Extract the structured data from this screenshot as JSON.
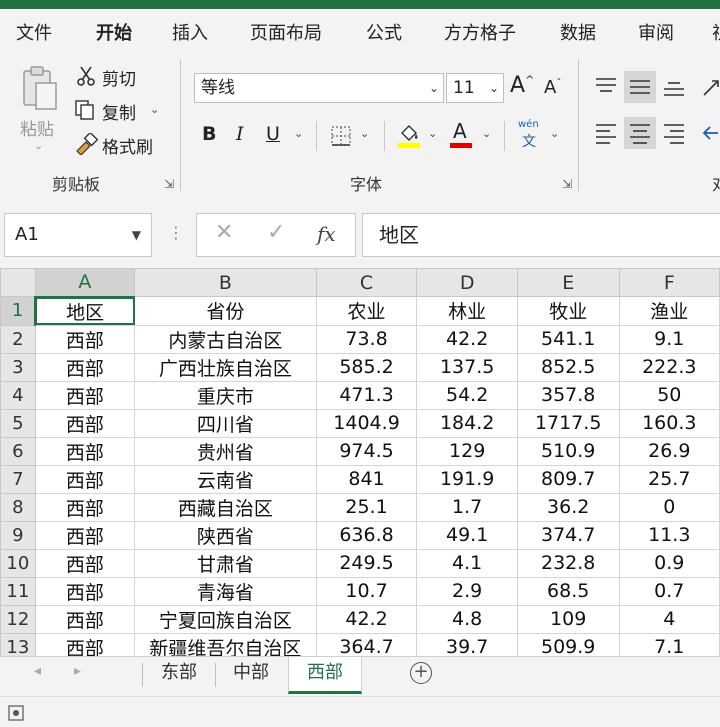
{
  "menu": {
    "tabs": [
      "文件",
      "开始",
      "插入",
      "页面布局",
      "公式",
      "方方格子",
      "数据",
      "审阅",
      "视"
    ],
    "active_index": 1
  },
  "ribbon": {
    "clipboard": {
      "paste": "粘贴",
      "cut": "剪切",
      "copy": "复制",
      "format_painter": "格式刷",
      "label": "剪贴板"
    },
    "font": {
      "font_name": "等线",
      "font_size": "11",
      "grow": "A",
      "shrink": "A",
      "bold": "B",
      "italic": "I",
      "underline": "U",
      "font_color_letter": "A",
      "phonetic_top": "wén",
      "phonetic_bottom": "文",
      "label": "字体",
      "fill_color": "#ffff00",
      "font_color": "#e00000"
    },
    "alignment": {
      "label_partial": "对"
    }
  },
  "formula_bar": {
    "name_box": "A1",
    "fx": "fx",
    "content": "地区"
  },
  "sheet": {
    "columns": [
      "A",
      "B",
      "C",
      "D",
      "E",
      "F"
    ],
    "rows": [
      [
        "地区",
        "省份",
        "农业",
        "林业",
        "牧业",
        "渔业"
      ],
      [
        "西部",
        "内蒙古自治区",
        "73.8",
        "42.2",
        "541.1",
        "9.1"
      ],
      [
        "西部",
        "广西壮族自治区",
        "585.2",
        "137.5",
        "852.5",
        "222.3"
      ],
      [
        "西部",
        "重庆市",
        "471.3",
        "54.2",
        "357.8",
        "50"
      ],
      [
        "西部",
        "四川省",
        "1404.9",
        "184.2",
        "1717.5",
        "160.3"
      ],
      [
        "西部",
        "贵州省",
        "974.5",
        "129",
        "510.9",
        "26.9"
      ],
      [
        "西部",
        "云南省",
        "841",
        "191.9",
        "809.7",
        "25.7"
      ],
      [
        "西部",
        "西藏自治区",
        "25.1",
        "1.7",
        "36.2",
        "0"
      ],
      [
        "西部",
        "陕西省",
        "636.8",
        "49.1",
        "374.7",
        "11.3"
      ],
      [
        "西部",
        "甘肃省",
        "249.5",
        "4.1",
        "232.8",
        "0.9"
      ],
      [
        "西部",
        "青海省",
        "10.7",
        "2.9",
        "68.5",
        "0.7"
      ],
      [
        "西部",
        "宁夏回族自治区",
        "42.2",
        "4.8",
        "109",
        "4"
      ],
      [
        "西部",
        "新疆维吾尔自治区",
        "364.7",
        "39.7",
        "509.9",
        "7.1"
      ]
    ]
  },
  "sheet_tabs": {
    "tabs": [
      "东部",
      "中部",
      "西部"
    ],
    "active_index": 2
  }
}
